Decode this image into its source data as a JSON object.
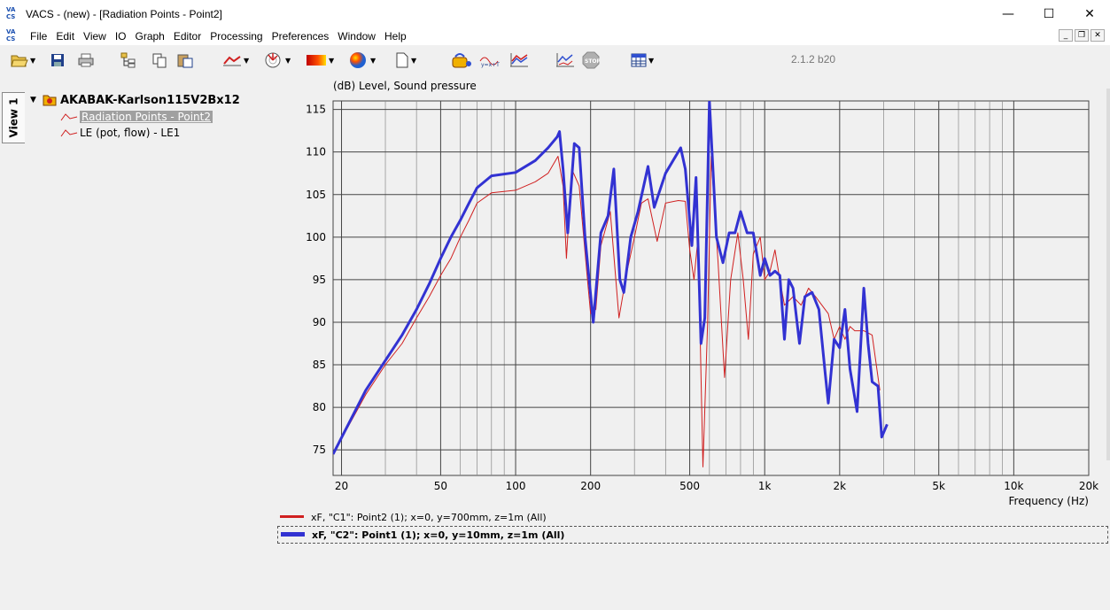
{
  "window": {
    "title": "VACS - (new) - [Radiation Points - Point2]",
    "logo_top": "VA",
    "logo_bottom": "CS",
    "minimize": "—",
    "maximize": "☐",
    "close": "✕"
  },
  "menu": {
    "items": [
      "File",
      "Edit",
      "View",
      "IO",
      "Graph",
      "Editor",
      "Processing",
      "Preferences",
      "Window",
      "Help"
    ]
  },
  "toolbar": {
    "version": "2.1.2 b20"
  },
  "side_tab": {
    "label": "View 1"
  },
  "tree": {
    "root": "AKABAK-Karlson115V2Bx12",
    "children": [
      {
        "label": "Radiation Points - Point2",
        "selected": true
      },
      {
        "label": "LE (pot, flow) - LE1",
        "selected": false
      }
    ]
  },
  "legend": [
    {
      "label": "xF, \"C1\": Point2 (1); x=0, y=700mm, z=1m  (All)",
      "color": "#d02020"
    },
    {
      "label": "xF, \"C2\": Point1 (1); x=0, y=10mm, z=1m  (All)",
      "color": "#3232d2"
    }
  ],
  "chart_data": {
    "type": "line",
    "title": "",
    "ylabel": "(dB)  Level, Sound pressure",
    "xlabel": "Frequency  (Hz)",
    "x_scale": "log",
    "xlim": [
      18.5,
      20000
    ],
    "ylim": [
      72,
      116
    ],
    "x_ticks": [
      {
        "v": 20,
        "label": "20"
      },
      {
        "v": 50,
        "label": "50"
      },
      {
        "v": 100,
        "label": "100"
      },
      {
        "v": 200,
        "label": "200"
      },
      {
        "v": 500,
        "label": "500"
      },
      {
        "v": 1000,
        "label": "1k"
      },
      {
        "v": 2000,
        "label": "2k"
      },
      {
        "v": 5000,
        "label": "5k"
      },
      {
        "v": 10000,
        "label": "10k"
      },
      {
        "v": 20000,
        "label": "20k"
      }
    ],
    "y_ticks": [
      75,
      80,
      85,
      90,
      95,
      100,
      105,
      110,
      115
    ],
    "grid": true,
    "series": [
      {
        "name": "xF, \"C1\": Point2 (1); x=0, y=700mm, z=1m  (All)",
        "color": "#d02020",
        "width": 1,
        "points": [
          [
            18.5,
            74.5
          ],
          [
            25,
            81.5
          ],
          [
            30,
            85
          ],
          [
            35,
            87.5
          ],
          [
            40,
            90.5
          ],
          [
            45,
            93
          ],
          [
            50,
            95.5
          ],
          [
            55,
            97.5
          ],
          [
            60,
            100
          ],
          [
            65,
            102
          ],
          [
            70,
            104
          ],
          [
            80,
            105.2
          ],
          [
            100,
            105.5
          ],
          [
            120,
            106.5
          ],
          [
            135,
            107.5
          ],
          [
            148,
            109.5
          ],
          [
            155,
            106
          ],
          [
            160,
            97.5
          ],
          [
            168,
            108
          ],
          [
            180,
            106
          ],
          [
            193,
            96
          ],
          [
            200,
            91
          ],
          [
            210,
            91.5
          ],
          [
            220,
            99
          ],
          [
            240,
            103
          ],
          [
            260,
            90.5
          ],
          [
            280,
            96
          ],
          [
            300,
            100
          ],
          [
            320,
            104
          ],
          [
            340,
            104.5
          ],
          [
            370,
            99.5
          ],
          [
            400,
            104
          ],
          [
            450,
            104.3
          ],
          [
            480,
            104.2
          ],
          [
            500,
            98.5
          ],
          [
            520,
            95
          ],
          [
            540,
            100
          ],
          [
            565,
            73
          ],
          [
            590,
            90
          ],
          [
            610,
            109.5
          ],
          [
            650,
            97
          ],
          [
            690,
            83.5
          ],
          [
            730,
            95
          ],
          [
            780,
            100.5
          ],
          [
            820,
            95
          ],
          [
            860,
            88
          ],
          [
            900,
            98
          ],
          [
            960,
            100
          ],
          [
            1000,
            95
          ],
          [
            1050,
            96
          ],
          [
            1100,
            98.5
          ],
          [
            1150,
            95
          ],
          [
            1200,
            92
          ],
          [
            1300,
            93
          ],
          [
            1400,
            92
          ],
          [
            1500,
            94
          ],
          [
            1600,
            93
          ],
          [
            1800,
            91
          ],
          [
            1900,
            88
          ],
          [
            2000,
            89.5
          ],
          [
            2100,
            88
          ],
          [
            2200,
            89.5
          ],
          [
            2300,
            89
          ],
          [
            2500,
            89
          ],
          [
            2700,
            88.5
          ],
          [
            2900,
            82
          ]
        ]
      },
      {
        "name": "xF, \"C2\": Point1 (1); x=0, y=10mm, z=1m  (All)",
        "color": "#3232d2",
        "width": 3,
        "points": [
          [
            18.5,
            74.5
          ],
          [
            25,
            82
          ],
          [
            30,
            85.5
          ],
          [
            35,
            88.5
          ],
          [
            40,
            91.5
          ],
          [
            45,
            94.5
          ],
          [
            50,
            97.5
          ],
          [
            55,
            100
          ],
          [
            60,
            102
          ],
          [
            65,
            104
          ],
          [
            70,
            105.8
          ],
          [
            80,
            107.2
          ],
          [
            100,
            107.6
          ],
          [
            120,
            109
          ],
          [
            135,
            110.5
          ],
          [
            147,
            111.8
          ],
          [
            150,
            112.4
          ],
          [
            155,
            108
          ],
          [
            162,
            100.5
          ],
          [
            172,
            111
          ],
          [
            180,
            110.5
          ],
          [
            190,
            100
          ],
          [
            205,
            90
          ],
          [
            220,
            100.5
          ],
          [
            235,
            102.5
          ],
          [
            248,
            108
          ],
          [
            262,
            95
          ],
          [
            272,
            93.5
          ],
          [
            290,
            100
          ],
          [
            310,
            103
          ],
          [
            340,
            108.3
          ],
          [
            360,
            103.5
          ],
          [
            400,
            107.5
          ],
          [
            460,
            110.5
          ],
          [
            480,
            108
          ],
          [
            510,
            99
          ],
          [
            530,
            107
          ],
          [
            555,
            87.5
          ],
          [
            575,
            90.5
          ],
          [
            600,
            116
          ],
          [
            620,
            108
          ],
          [
            640,
            100
          ],
          [
            680,
            97
          ],
          [
            720,
            100.5
          ],
          [
            760,
            100.5
          ],
          [
            800,
            103
          ],
          [
            850,
            100.5
          ],
          [
            900,
            100.5
          ],
          [
            960,
            95.5
          ],
          [
            1000,
            97.5
          ],
          [
            1050,
            95.5
          ],
          [
            1100,
            96
          ],
          [
            1150,
            95.5
          ],
          [
            1200,
            88
          ],
          [
            1250,
            95
          ],
          [
            1300,
            94
          ],
          [
            1380,
            87.5
          ],
          [
            1450,
            93
          ],
          [
            1550,
            93.5
          ],
          [
            1650,
            91.5
          ],
          [
            1750,
            84
          ],
          [
            1800,
            80.5
          ],
          [
            1900,
            88
          ],
          [
            2000,
            87
          ],
          [
            2100,
            91.5
          ],
          [
            2200,
            84.5
          ],
          [
            2350,
            79.5
          ],
          [
            2500,
            94
          ],
          [
            2600,
            87.5
          ],
          [
            2700,
            83
          ],
          [
            2850,
            82.5
          ],
          [
            2950,
            76.5
          ],
          [
            3100,
            78
          ]
        ]
      }
    ]
  }
}
